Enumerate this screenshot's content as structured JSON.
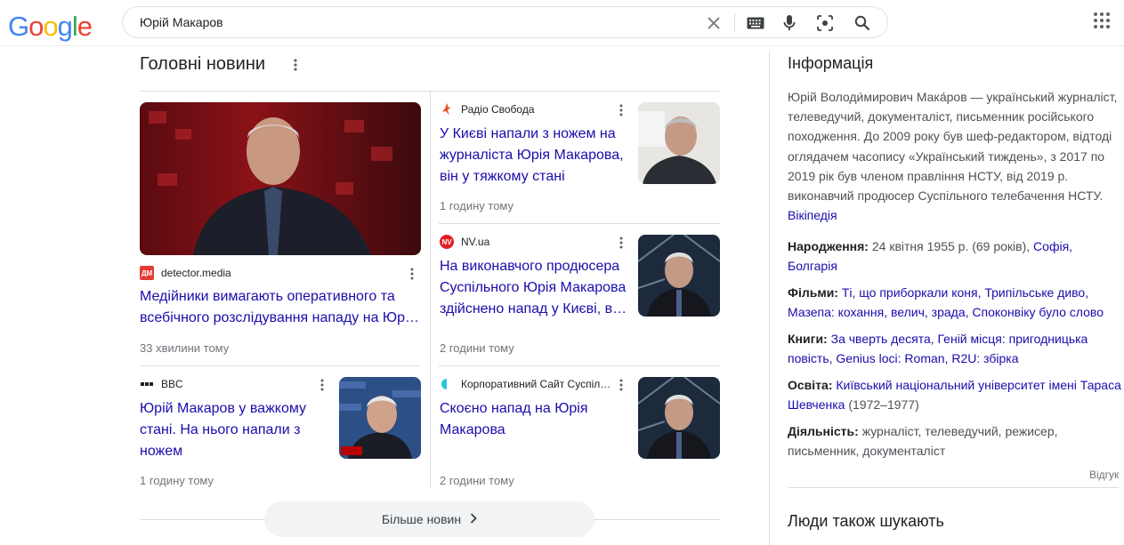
{
  "header": {
    "logo": "Google",
    "search_value": "Юрій Макаров"
  },
  "news": {
    "title": "Головні новини",
    "more_label": "Більше новин",
    "items": [
      {
        "source": "detector.media",
        "fav": "ДМ",
        "headline": "Медійники вимагають оперативного та всебічного розслідування нападу на Юр…",
        "time": "33 хвилини тому"
      },
      {
        "source": "Радіо Свобода",
        "headline": "У Києві напали з ножем на журналіста Юрія Макарова, він у тяжкому стані",
        "time": "1 годину тому"
      },
      {
        "source": "NV.ua",
        "fav": "NV",
        "headline": "На виконавчого продюсера Суспільного Юрія Макарова здійснено напад у Києві, в…",
        "time": "2 години тому"
      },
      {
        "source": "BBC",
        "headline": "Юрій Макаров у важкому стані. На нього напали з ножем",
        "time": "1 годину тому"
      },
      {
        "source": "Корпоративний Сайт Суспіл…",
        "headline": "Скоєно напад на Юрія Макарова",
        "time": "2 години тому"
      }
    ]
  },
  "info": {
    "title": "Інформація",
    "description": "Юрій Володи́мирович Мака́ров — український журналіст, телеведучий, документаліст, письменник російського походження. До 2009 року був шеф-редактором, відтоді оглядачем часопису «Український тиждень», з 2017 по 2019 рік був членом правління НСТУ, від 2019 р. виконавчий продюсер Суспільного телебачення НСТУ.",
    "wiki": "Вікіпедія",
    "birth_label": "Народження:",
    "birth_text": "24 квітня 1955 р. (69 років),",
    "birth_link1": "Софія,",
    "birth_link2": "Болгарія",
    "films_label": "Фільми:",
    "films": "Ті, що приборкали коня, Трипільське диво, Мазепа: кохання, велич, зрада, Споконвіку було слово",
    "books_label": "Книги:",
    "books": "За чверть десята, Геній місця: пригодницька повість, Genius loci: Roman, R2U: збірка",
    "edu_label": "Освіта:",
    "edu_link": "Київський національний університет імені Тараса Шевченка",
    "edu_years": "(1972–1977)",
    "activity_label": "Діяльність:",
    "activity": "журналіст, телеведучий, режисер, письменник, документаліст",
    "feedback": "Відгук",
    "people_also": "Люди також шукають"
  },
  "colors": {
    "link": "#1a0dab",
    "google_blue": "#4285F4",
    "google_red": "#EA4335",
    "google_yellow": "#FBBC05",
    "google_green": "#34A853"
  }
}
